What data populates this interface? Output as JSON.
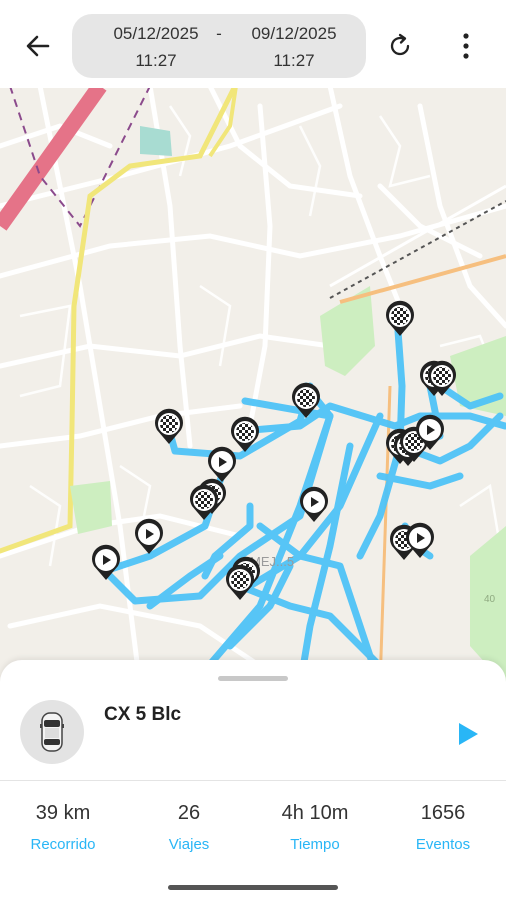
{
  "header": {
    "back_icon": "arrow-left-icon",
    "date_from": "05/12/2025",
    "time_from": "11:27",
    "separator": "-",
    "date_to": "09/12/2025",
    "time_to": "11:27",
    "refresh_icon": "refresh-icon",
    "more_icon": "more-vert-icon"
  },
  "map": {
    "label_street": "MEJ...5",
    "contour_label": "40",
    "route_color": "#4fc3f7",
    "start_icon": "play-marker-icon",
    "end_icon": "checkered-flag-marker-icon"
  },
  "vehicle": {
    "name": "CX 5 Blc",
    "icon": "car-top-view-icon",
    "play_icon": "play-icon"
  },
  "stats": [
    {
      "value": "39 km",
      "label": "Recorrido"
    },
    {
      "value": "26",
      "label": "Viajes"
    },
    {
      "value": "4h 10m",
      "label": "Tiempo"
    },
    {
      "value": "1656",
      "label": "Eventos"
    }
  ],
  "colors": {
    "accent": "#29b6f6",
    "map_bg": "#f2efe9",
    "pill_bg": "#e6e6e6"
  }
}
